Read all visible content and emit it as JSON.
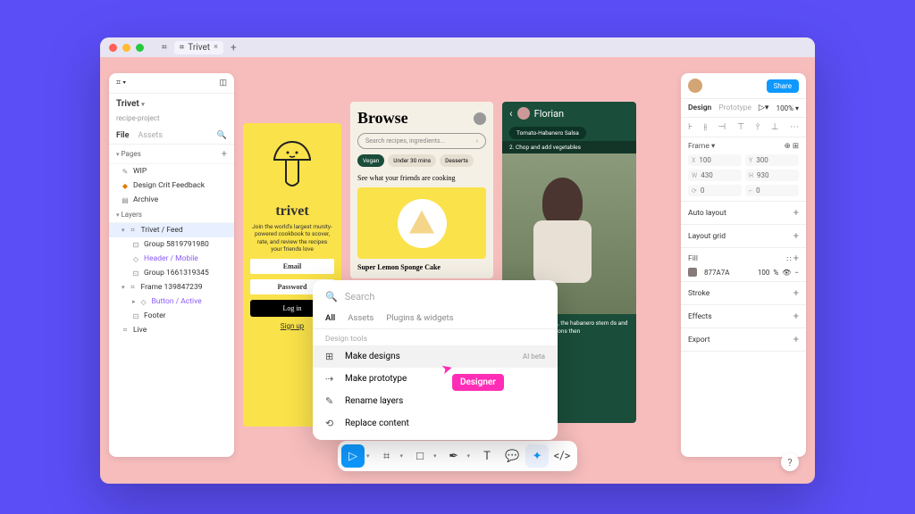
{
  "tab": {
    "name": "Trivet"
  },
  "left": {
    "project": "Trivet",
    "subtitle": "recipe-project",
    "tabs": {
      "file": "File",
      "assets": "Assets"
    },
    "pages_label": "Pages",
    "pages": [
      "WIP",
      "Design Crit Feedback",
      "Archive"
    ],
    "layers_label": "Layers",
    "layers": {
      "trivet": "Trivet / Feed",
      "g1": "Group 5819791980",
      "header": "Header / Mobile",
      "g2": "Group 1661319345",
      "frame": "Frame 139847239",
      "button": "Button / Active",
      "footer": "Footer",
      "live": "Live"
    }
  },
  "right": {
    "share": "Share",
    "tabs": {
      "design": "Design",
      "proto": "Prototype"
    },
    "zoom": "100%",
    "frame_label": "Frame",
    "dims": {
      "x": "100",
      "y": "300",
      "w": "430",
      "h": "930",
      "r": "0",
      "c": "0"
    },
    "auto_layout": "Auto layout",
    "layout_grid": "Layout grid",
    "fill": "Fill",
    "fill_val": "877A7A",
    "fill_pct": "100",
    "fill_unit": "%",
    "stroke": "Stroke",
    "effects": "Effects",
    "export": "Export"
  },
  "frame1": {
    "brand": "trivet",
    "blurb": "Join the world's largest munity-powered cookbook to scover, rate, and review the recipes your friends love",
    "email": "Email",
    "password": "Password",
    "login": "Log in",
    "signup": "Sign up"
  },
  "frame2": {
    "title": "Browse",
    "search_ph": "Search recipes, ingredients...",
    "chips": [
      "Vegan",
      "Under 30 mins",
      "Desserts"
    ],
    "subtitle": "See what your friends are cooking",
    "caption": "Super Lemon Sponge Cake"
  },
  "frame3": {
    "name": "Florian",
    "tag": "Tomato-Habanero Salsa",
    "step": "2. Chop and add vegetables",
    "body": "large cutting board, the habanero stem ds and finely chop. the onions then"
  },
  "popup": {
    "search": "Search",
    "tabs": {
      "all": "All",
      "assets": "Assets",
      "plugins": "Plugins & widgets"
    },
    "section": "Design tools",
    "items": {
      "make_designs": "Make designs",
      "make_proto": "Make prototype",
      "rename": "Rename layers",
      "replace": "Replace content"
    },
    "badge": "AI beta"
  },
  "cursor": "Designer"
}
